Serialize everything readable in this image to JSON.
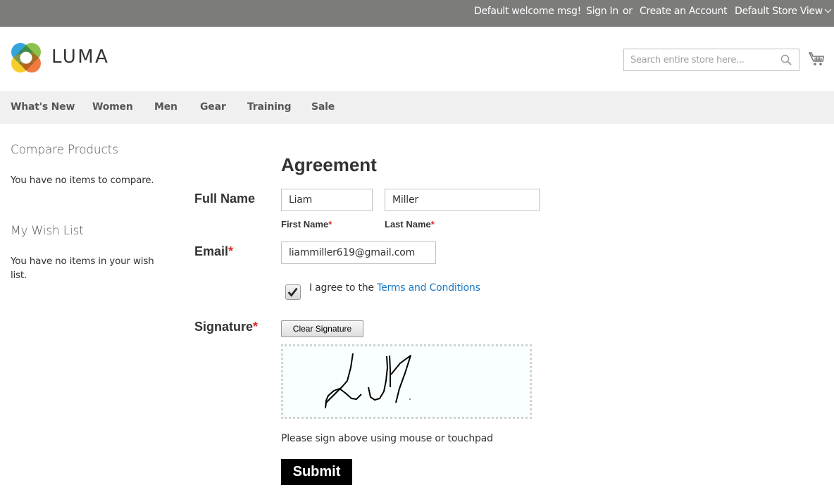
{
  "topbar": {
    "welcome": "Default welcome msg!",
    "sign_in": "Sign In",
    "or": "or",
    "create_account": "Create an Account",
    "store_view": "Default Store View"
  },
  "header": {
    "logo_text": "LUMA",
    "search_placeholder": "Search entire store here...",
    "icons": [
      "luma-logo-icon",
      "search-icon",
      "cart-icon"
    ]
  },
  "nav": {
    "items": [
      "What's New",
      "Women",
      "Men",
      "Gear",
      "Training",
      "Sale"
    ]
  },
  "sidebar": {
    "compare_title": "Compare Products",
    "compare_text": "You have no items to compare.",
    "wishlist_title": "My Wish List",
    "wishlist_text": "You have no items in your wish list."
  },
  "form": {
    "title": "Agreement",
    "full_name_label": "Full Name",
    "first_name_value": "Liam",
    "first_name_label": "First Name",
    "last_name_value": "Miller",
    "last_name_label": "Last Name",
    "email_label": "Email",
    "email_value": "liammiller619@gmail.com",
    "required_marker": "*",
    "agree_checked": true,
    "agree_text": "I agree to the ",
    "terms_link": "Terms and Conditions",
    "signature_label": "Signature",
    "clear_signature": "Clear Signature",
    "signature_hint": "Please sign above using mouse or touchpad",
    "submit": "Submit"
  },
  "colors": {
    "topbar_bg": "#7c7d7b",
    "nav_bg": "#f0f0f0",
    "link": "#1979c3",
    "required": "#e02b27",
    "submit_bg": "#000000"
  }
}
